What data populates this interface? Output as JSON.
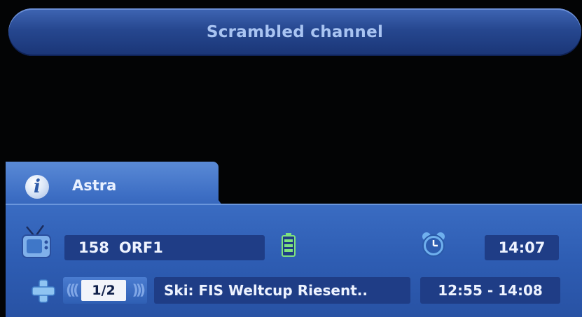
{
  "banner": {
    "message": "Scrambled channel"
  },
  "info": {
    "satellite": "Astra"
  },
  "channel": {
    "number": "158",
    "name": "ORF1",
    "clock": "14:07"
  },
  "program": {
    "subtitle_track": "1/2",
    "title": "Ski: FIS Weltcup Riesent..",
    "time_range": "12:55 - 14:08"
  },
  "colors": {
    "panel": "#2e5db3",
    "field": "#1f3d86",
    "banner": "#26478f",
    "text": "#eef3ff"
  }
}
